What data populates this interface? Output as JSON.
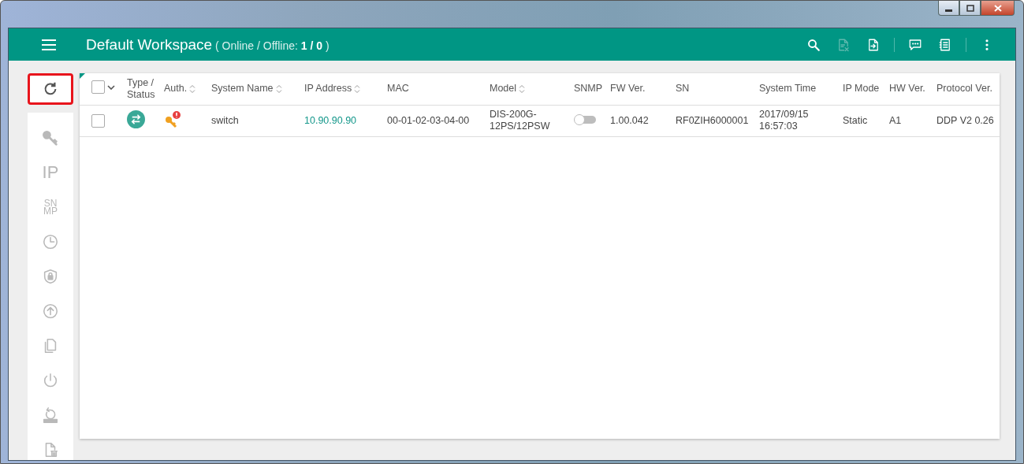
{
  "window": {
    "controls": [
      {
        "kind": "minimize"
      },
      {
        "kind": "restore"
      },
      {
        "kind": "close"
      }
    ]
  },
  "header": {
    "title": "Default Workspace",
    "status_label": "( Online / Offline: ",
    "status_value": "1 / 0",
    "status_end": " )",
    "actions": [
      {
        "kind": "search",
        "disabled": false
      },
      {
        "kind": "file-x",
        "disabled": true
      },
      {
        "kind": "file-export",
        "disabled": false
      },
      {
        "kind": "divider"
      },
      {
        "kind": "chat",
        "disabled": false
      },
      {
        "kind": "list",
        "disabled": false
      },
      {
        "kind": "divider"
      },
      {
        "kind": "more",
        "disabled": false
      }
    ]
  },
  "sidebar": {
    "refresh": {
      "highlighted": true
    },
    "tools": [
      {
        "kind": "key"
      },
      {
        "kind": "text",
        "lines": [
          "IP"
        ]
      },
      {
        "kind": "text",
        "lines": [
          "SN",
          "MP"
        ]
      },
      {
        "kind": "clock"
      },
      {
        "kind": "shield"
      },
      {
        "kind": "upload"
      },
      {
        "kind": "copy"
      },
      {
        "kind": "power"
      },
      {
        "kind": "restore"
      },
      {
        "kind": "file-delete"
      }
    ]
  },
  "table": {
    "select_all": {
      "checked": false
    },
    "columns": [
      {
        "label": "Type /\nStatus",
        "sort": false
      },
      {
        "label": "Auth.",
        "sort": true
      },
      {
        "label": "System Name",
        "sort": true
      },
      {
        "label": "IP Address",
        "sort": true
      },
      {
        "label": "MAC",
        "sort": false
      },
      {
        "label": "Model",
        "sort": true
      },
      {
        "label": "SNMP",
        "sort": false
      },
      {
        "label": "FW Ver.",
        "sort": false
      },
      {
        "label": "SN",
        "sort": false
      },
      {
        "label": "System Time",
        "sort": false
      },
      {
        "label": "IP Mode",
        "sort": false
      },
      {
        "label": "HW Ver.",
        "sort": false
      },
      {
        "label": "Protocol Ver.",
        "sort": false
      }
    ],
    "rows": [
      {
        "checked": false,
        "auth_warning": true,
        "system_name": "switch",
        "ip": "10.90.90.90",
        "mac": "00-01-02-03-04-00",
        "model": "DIS-200G-\n12PS/12PSW",
        "snmp_on": false,
        "fw": "1.00.042",
        "sn": "RF0ZIH6000001",
        "time": "2017/09/15\n16:57:03",
        "ip_mode": "Static",
        "hw": "A1",
        "protocol": "DDP V2 0.26"
      }
    ]
  }
}
